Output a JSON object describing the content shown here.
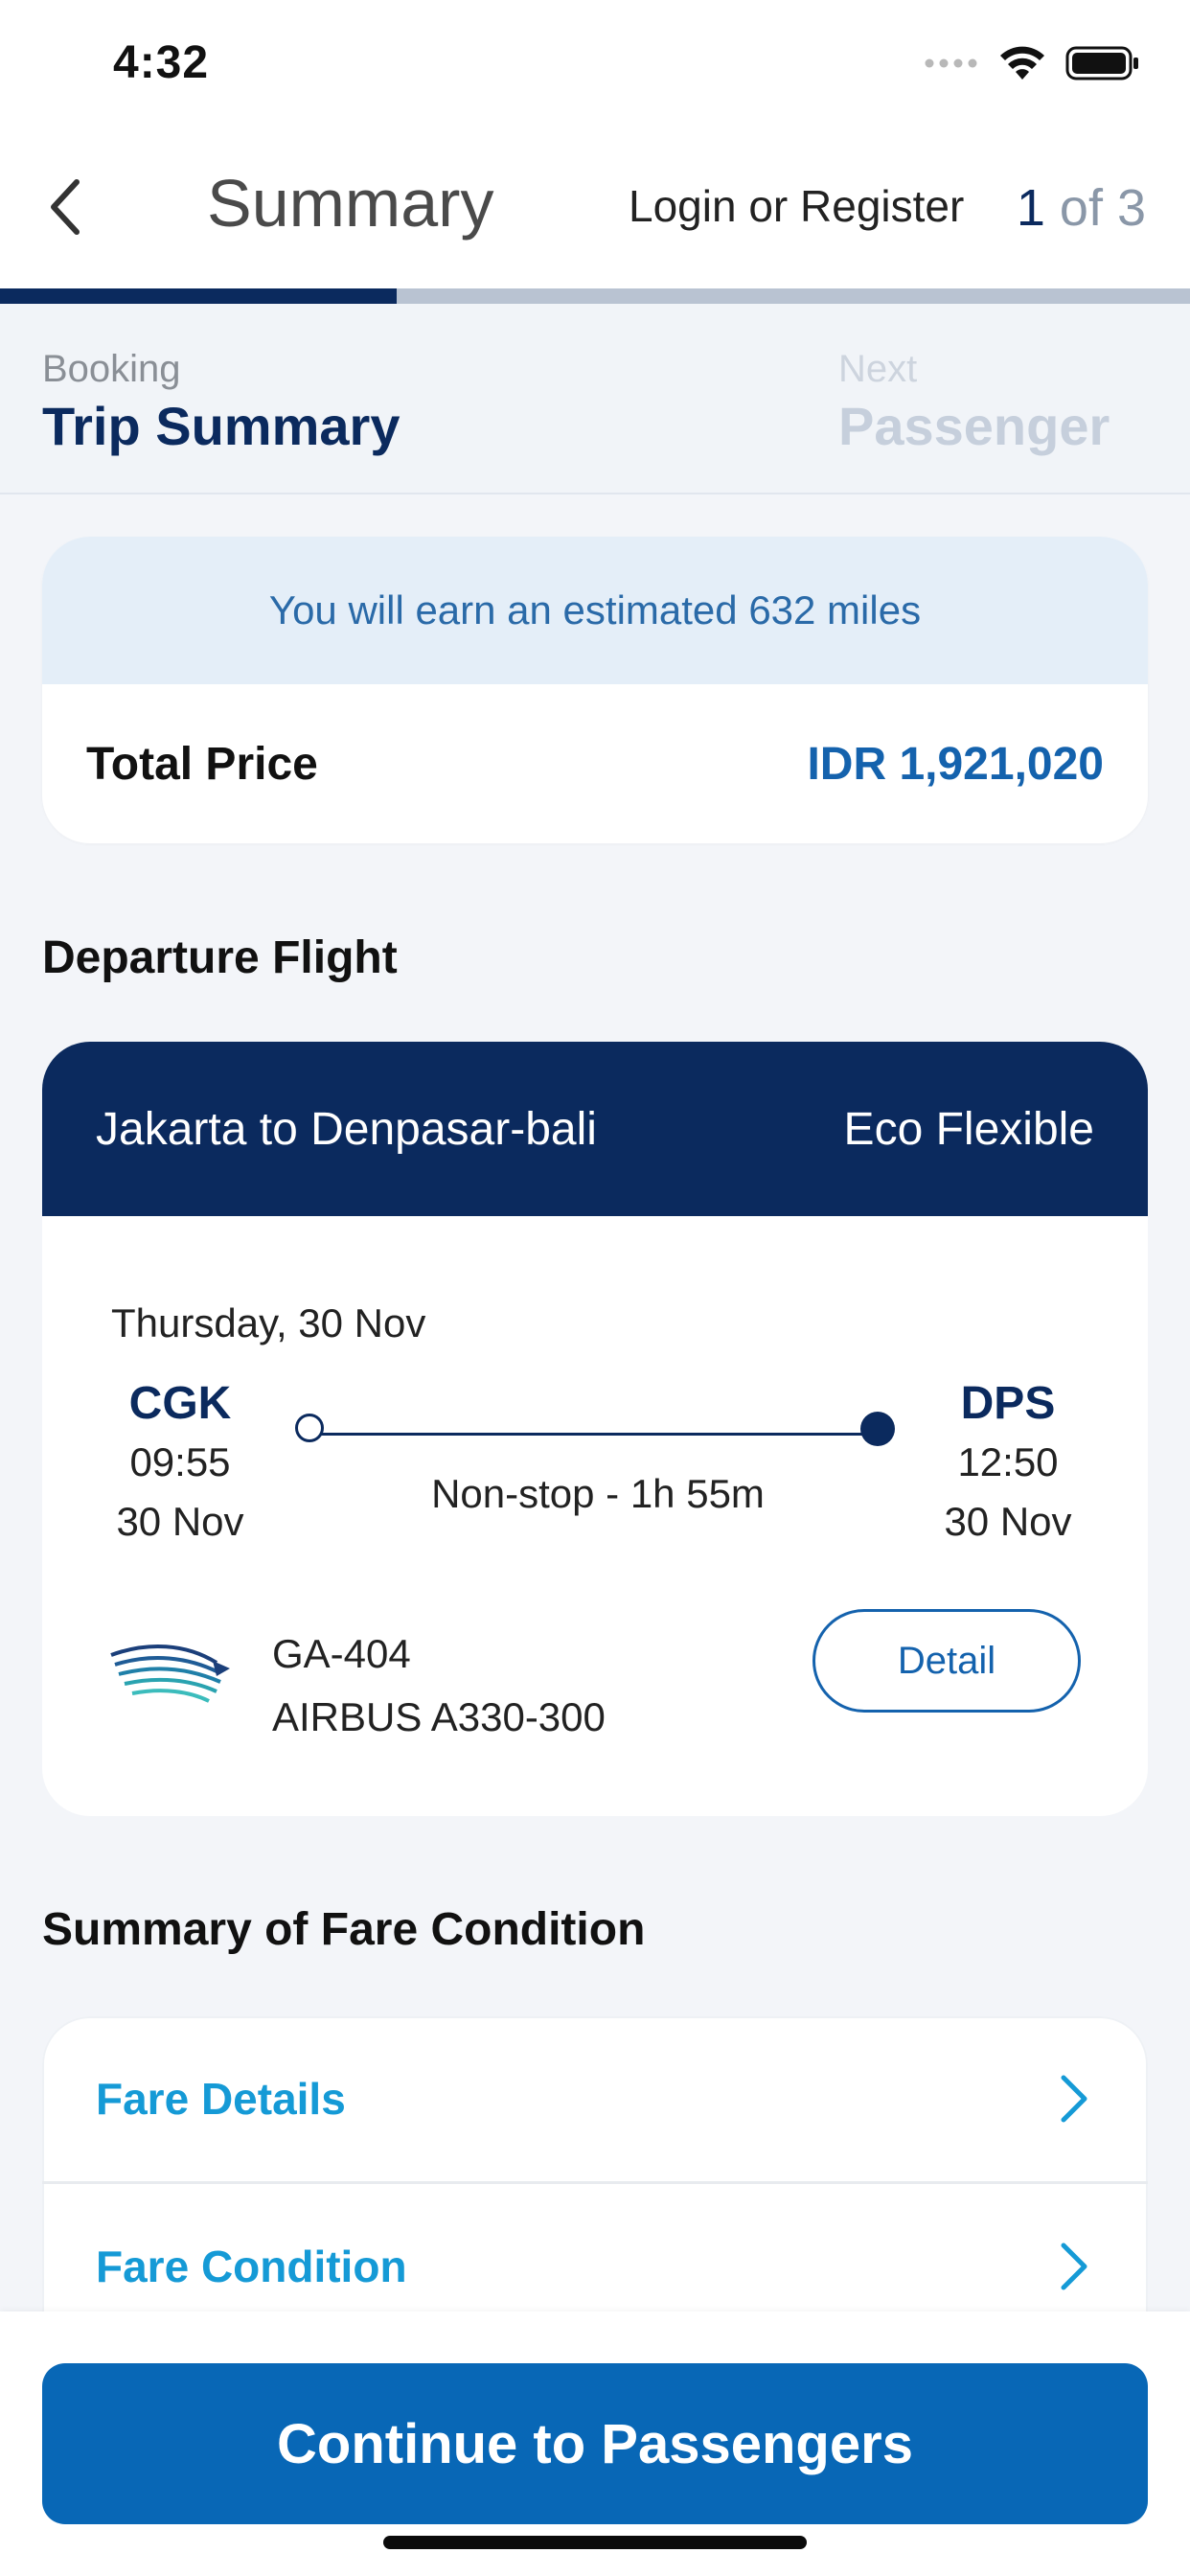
{
  "status_bar": {
    "time": "4:32"
  },
  "header": {
    "title": "Summary",
    "login_label": "Login or Register",
    "step_current": "1",
    "step_rest": " of 3"
  },
  "progress": {
    "current_step": 1,
    "total_steps": 3
  },
  "breadcrumb": {
    "current": {
      "label": "Booking",
      "title": "Trip Summary"
    },
    "next": {
      "label": "Next",
      "title": "Passenger"
    }
  },
  "price_card": {
    "miles_text": "You will earn an estimated 632 miles",
    "total_label": "Total Price",
    "total_value": "IDR 1,921,020"
  },
  "departure": {
    "section_title": "Departure Flight",
    "route": "Jakarta to Denpasar-bali",
    "fare_class": "Eco Flexible",
    "date": "Thursday, 30 Nov",
    "origin": {
      "code": "CGK",
      "time": "09:55",
      "date": "30 Nov"
    },
    "destination": {
      "code": "DPS",
      "time": "12:50",
      "date": "30 Nov"
    },
    "duration": "Non-stop - 1h 55m",
    "flight_number": "GA-404",
    "aircraft": "AIRBUS A330-300",
    "detail_label": "Detail",
    "airline_logo": "garuda-logo"
  },
  "fare": {
    "section_title": "Summary of Fare Condition",
    "items": [
      {
        "label": "Fare Details"
      },
      {
        "label": "Fare Condition"
      }
    ]
  },
  "footer": {
    "continue_label": "Continue to Passengers"
  },
  "colors": {
    "navy": "#0b2a5e",
    "primary_blue": "#0867b6",
    "price_blue": "#1462ad",
    "link_blue": "#159ad6",
    "miles_bg": "#e4eef8"
  }
}
